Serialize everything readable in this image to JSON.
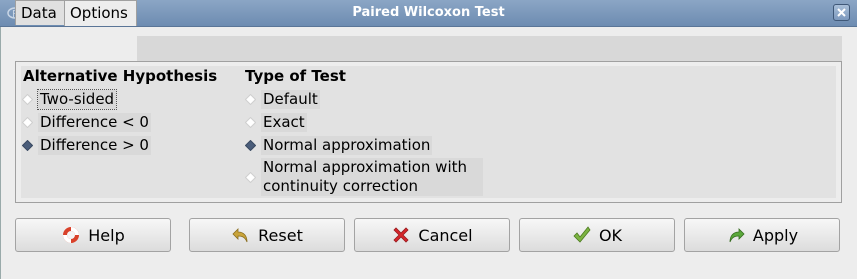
{
  "window": {
    "title": "Paired Wilcoxon Test"
  },
  "tabs": [
    {
      "label": "Data",
      "active": false
    },
    {
      "label": "Options",
      "active": true
    }
  ],
  "alternative": {
    "heading": "Alternative Hypothesis",
    "options": [
      {
        "label": "Two-sided",
        "selected": false
      },
      {
        "label": "Difference < 0",
        "selected": false
      },
      {
        "label": "Difference > 0",
        "selected": true
      }
    ]
  },
  "test_type": {
    "heading": "Type of Test",
    "options": [
      {
        "label": "Default",
        "selected": false
      },
      {
        "label": "Exact",
        "selected": false
      },
      {
        "label": "Normal approximation",
        "selected": true
      },
      {
        "label": "Normal approximation with continuity correction",
        "selected": false
      }
    ]
  },
  "buttons": {
    "help": "Help",
    "reset": "Reset",
    "cancel": "Cancel",
    "ok": "OK",
    "apply": "Apply"
  },
  "colors": {
    "titlebar": "#7b98bd",
    "radio_selected": "#4a5d7a"
  }
}
